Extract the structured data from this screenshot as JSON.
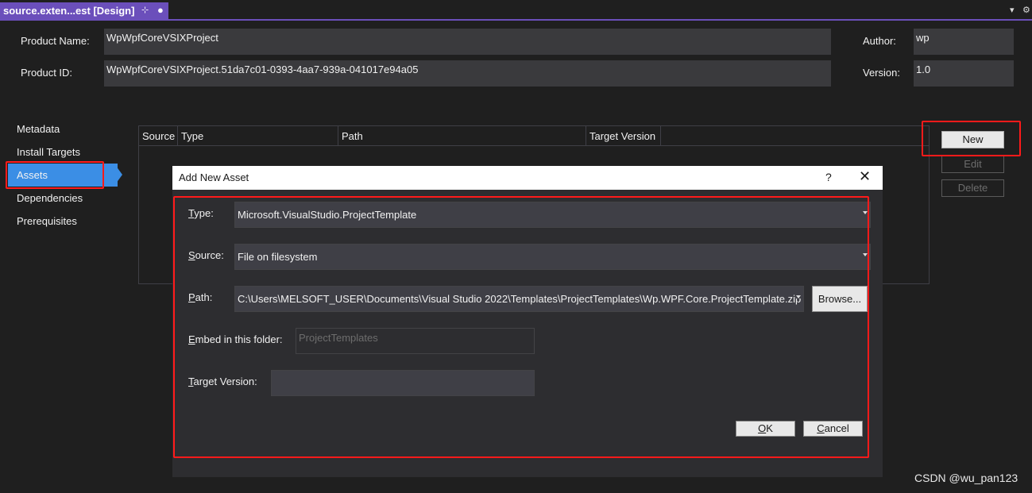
{
  "tab": {
    "title": "source.exten...est [Design]",
    "pin_icon": "⊹",
    "dot": "●"
  },
  "strip_right": {
    "dropdown_icon": "▾",
    "settings_icon": "⚙"
  },
  "header": {
    "product_name_label": "Product Name:",
    "product_name_value": "WpWpfCoreVSIXProject",
    "product_id_label": "Product ID:",
    "product_id_value": "WpWpfCoreVSIXProject.51da7c01-0393-4aa7-939a-041017e94a05",
    "author_label": "Author:",
    "author_value": "wp",
    "version_label": "Version:",
    "version_value": "1.0"
  },
  "nav": {
    "items": [
      "Metadata",
      "Install Targets",
      "Assets",
      "Dependencies",
      "Prerequisites"
    ],
    "selected": "Assets"
  },
  "table": {
    "columns": [
      "Source",
      "Type",
      "Path",
      "Target Version"
    ]
  },
  "buttons": {
    "new": "New",
    "edit": "Edit",
    "delete": "Delete"
  },
  "dialog": {
    "title": "Add New Asset",
    "help": "?",
    "close": "✕",
    "type_label_key": "T",
    "type_label_rest": "ype:",
    "type_value": "Microsoft.VisualStudio.ProjectTemplate",
    "source_label_key": "S",
    "source_label_rest": "ource:",
    "source_value": "File on filesystem",
    "path_label_key": "P",
    "path_label_rest": "ath:",
    "path_value": "C:\\Users\\MELSOFT_USER\\Documents\\Visual Studio 2022\\Templates\\ProjectTemplates\\Wp.WPF.Core.ProjectTemplate.zip",
    "browse": "Browse...",
    "embed_label_key": "E",
    "embed_label_rest": "mbed in this folder:",
    "embed_value": "ProjectTemplates",
    "target_label_key": "T",
    "target_label_rest": "arget Version:",
    "target_value": "",
    "ok_key": "O",
    "ok_rest": "K",
    "cancel_key": "C",
    "cancel_rest": "ancel"
  },
  "watermark": "CSDN @wu_pan123",
  "colors": {
    "accent": "#6b4fbb",
    "selection": "#3b8ee5",
    "highlight": "#ff1a1a"
  }
}
